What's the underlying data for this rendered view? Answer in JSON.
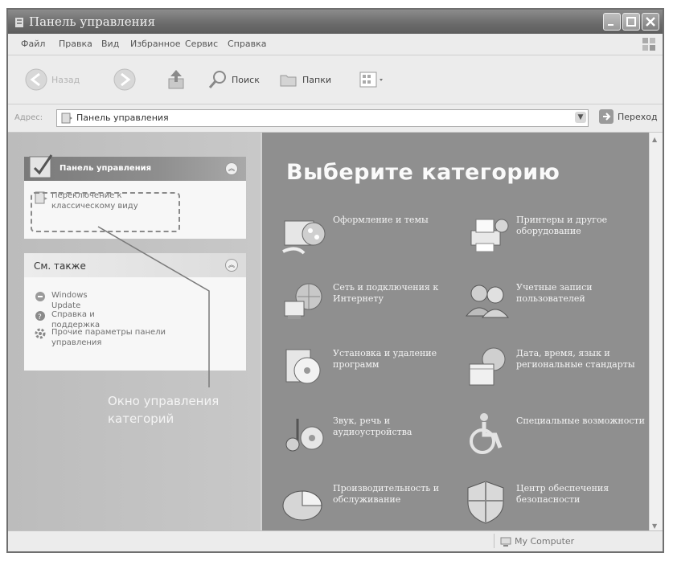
{
  "window": {
    "title": "Панель управления"
  },
  "menu": [
    "Файл",
    "Правка",
    "Вид",
    "Избранное",
    "Сервис",
    "Справка"
  ],
  "toolbar": {
    "back": "Назад",
    "search": "Поиск",
    "folders": "Папки"
  },
  "address": {
    "label": "Адрес:",
    "value": "Панель управления",
    "go": "Переход"
  },
  "leftpane": {
    "panel_title": "Панель управления",
    "switch_link": "Переключение к классическому виду",
    "see_also_title": "См. также",
    "see_also": [
      "Windows Update",
      "Справка и поддержка",
      "Прочие параметры панели управления"
    ],
    "callout": "Окно управления категорий"
  },
  "main": {
    "heading": "Выберите категорию",
    "categories": [
      "Оформление и темы",
      "Принтеры и другое оборудование",
      "Сеть и подключения к Интернету",
      "Учетные записи пользователей",
      "Установка и удаление программ",
      "Дата, время, язык и региональные стандарты",
      "Звук, речь и аудиоустройства",
      "Специальные возможности",
      "Производительность и обслуживание",
      "Центр обеспечения безопасности"
    ]
  },
  "status": {
    "text": "My Computer"
  },
  "colors": {
    "title_bar": "#6a6a6a",
    "main_pane": "#8f8f8f",
    "left_pane": "#c4c4c4"
  }
}
